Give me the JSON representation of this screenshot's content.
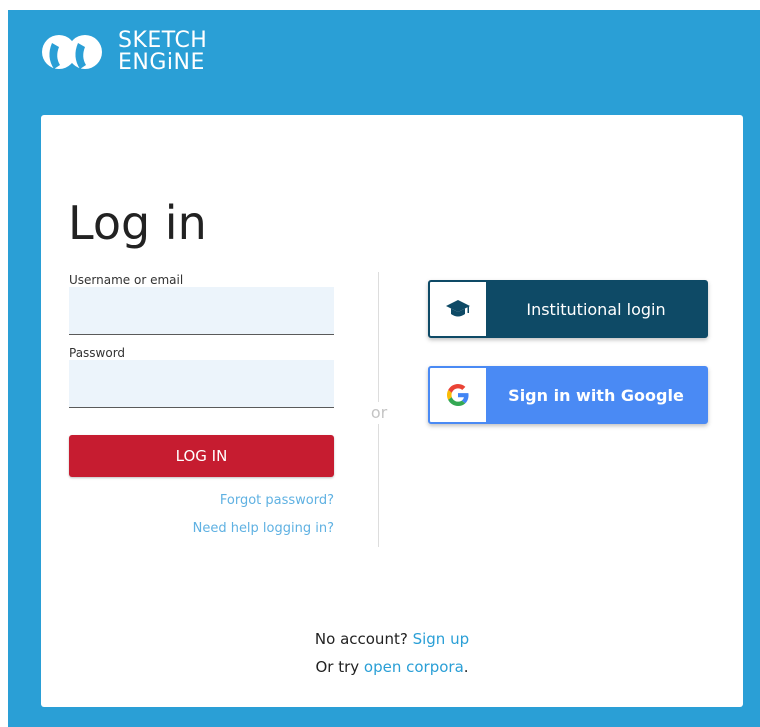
{
  "brand": {
    "line1": "SKETCH",
    "line2": "ENGiNE",
    "color": "#2a9fd6"
  },
  "login": {
    "title": "Log in",
    "username_label": "Username or email",
    "username_value": "",
    "password_label": "Password",
    "password_value": "",
    "submit_label": "LOG IN",
    "forgot_password": "Forgot password?",
    "need_help": "Need help logging in?",
    "submit_color": "#c61c30"
  },
  "separator": {
    "label": "or"
  },
  "sso": {
    "institutional_label": "Institutional login",
    "institutional_icon": "graduation-cap-icon",
    "institutional_color": "#0e4a66",
    "google_label": "Sign in with Google",
    "google_icon": "google-icon",
    "google_color": "#4a8af4"
  },
  "footer": {
    "no_account": "No account?",
    "sign_up": "Sign up",
    "or_try": "Or try",
    "open_corpora": "open corpora",
    "period": "."
  }
}
